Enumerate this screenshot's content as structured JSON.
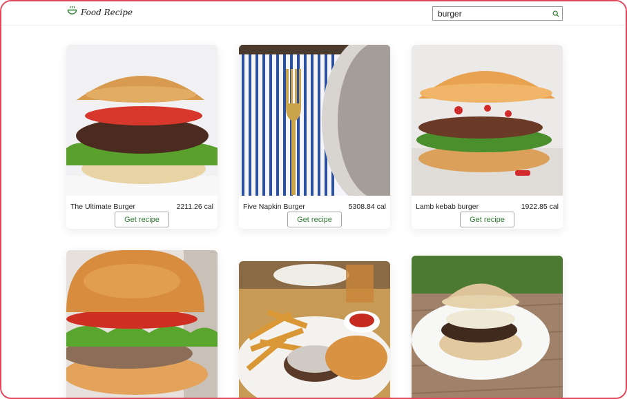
{
  "header": {
    "logo_text": "Food Recipe",
    "search_value": "burger",
    "accent_color": "#2e7d32",
    "border_color": "#e2485b"
  },
  "recipes": [
    {
      "name": "The Ultimate Burger",
      "calories": "2211.26 cal",
      "button": "Get recipe"
    },
    {
      "name": "Five Napkin Burger",
      "calories": "5308.84 cal",
      "button": "Get recipe"
    },
    {
      "name": "Lamb kebab burger",
      "calories": "1922.85 cal",
      "button": "Get recipe"
    },
    {
      "name": "",
      "calories": "",
      "button": ""
    },
    {
      "name": "",
      "calories": "",
      "button": ""
    },
    {
      "name": "",
      "calories": "",
      "button": ""
    }
  ],
  "icons": [
    "bowl-icon",
    "search-icon"
  ]
}
